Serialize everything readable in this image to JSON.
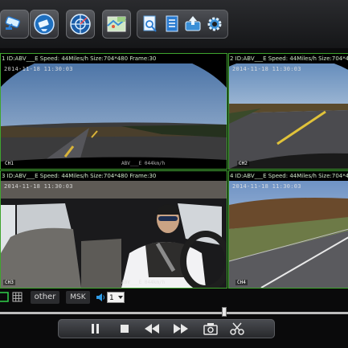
{
  "toolbar": {
    "buttons": [
      {
        "name": "cctv-camera-icon"
      },
      {
        "name": "camera-settings-icon"
      },
      {
        "name": "gps-target-icon"
      },
      {
        "name": "map-icon"
      }
    ],
    "group": [
      {
        "name": "search-document-icon"
      },
      {
        "name": "notes-icon"
      },
      {
        "name": "export-icon"
      },
      {
        "name": "gear-icon"
      }
    ]
  },
  "channels": [
    {
      "caption": "1 ID:ABV___E Speed: 44Miles/h  Size:704*480  Frame:30",
      "timestamp": "2014-11-18  11:30:03",
      "label": "CH1",
      "overlay": "ABV___E  044km/h"
    },
    {
      "caption": "2  ID:ABV___E Speed: 44Miles/h  Size:704*480  Frame",
      "timestamp": "2014-11-18  11:30:03",
      "label": "CH2",
      "overlay": ""
    },
    {
      "caption": "3  ID:ABV___E Speed: 44Miles/h  Size:704*480  Frame:30",
      "timestamp": "2014-11-18  11:30:03",
      "label": "CH3",
      "overlay": "ABV___E  044km/h"
    },
    {
      "caption": "4  ID:ABV___E Speed: 44Miles/h  Size:704*480  Frame",
      "timestamp": "2014-11-18  11:30:03",
      "label": "CH4",
      "overlay": ""
    }
  ],
  "controls": {
    "other_label": "other",
    "msk_label": "MSK",
    "channel_select_value": "1"
  },
  "timeline": {
    "position": 0.645
  },
  "playback": [
    {
      "name": "pause-icon"
    },
    {
      "name": "stop-icon"
    },
    {
      "name": "rewind-icon"
    },
    {
      "name": "fast-forward-icon"
    },
    {
      "name": "snapshot-camera-icon"
    },
    {
      "name": "clip-scissors-icon"
    }
  ],
  "colors": {
    "accent_green": "#3fa52e",
    "toolbar_bg": "#1e1f22"
  }
}
